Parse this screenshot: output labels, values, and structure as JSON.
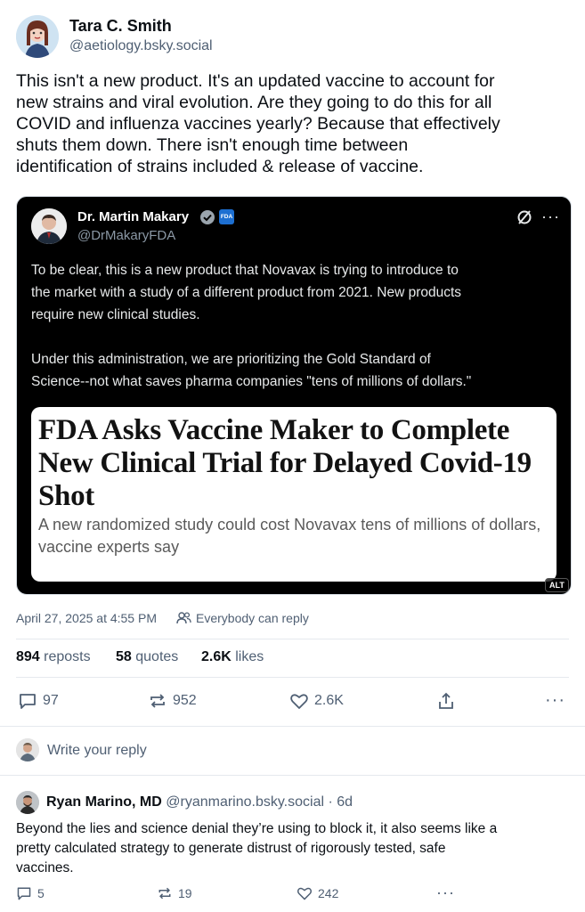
{
  "post": {
    "author_name": "Tara C. Smith",
    "author_handle": "@aetiology.bsky.social",
    "text_lines": [
      "This isn't a new product. It's an updated vaccine to account for",
      "new strains and viral evolution. Are they going to do this for all",
      "COVID and influenza vaccines yearly? Because that effectively",
      "shuts them down. There isn't enough time between",
      "identification of strains included & release of vaccine."
    ],
    "timestamp": "April 27, 2025 at 4:55 PM",
    "reply_setting": "Everybody can reply",
    "stats": {
      "reposts_count": "894",
      "reposts_label": "reposts",
      "quotes_count": "58",
      "quotes_label": "quotes",
      "likes_count": "2.6K",
      "likes_label": "likes"
    },
    "actions": {
      "replies": "97",
      "reposts": "952",
      "likes": "2.6K"
    }
  },
  "embed": {
    "author_name": "Dr. Martin Makary",
    "author_handle": "@DrMakaryFDA",
    "badge_text": "FDA",
    "paragraph1_lines": [
      "To be clear, this is a new product that Novavax is trying to introduce to",
      "the market with a study of a different product from 2021. New products",
      "require new clinical studies."
    ],
    "paragraph2_lines": [
      "Under this administration, we are prioritizing the Gold Standard of",
      "Science--not what saves pharma companies \"tens of millions of dollars.\""
    ],
    "headline_lines": [
      "FDA Asks Vaccine Maker to Complete",
      "New Clinical Trial for Delayed Covid-19",
      "Shot"
    ],
    "dek_lines": [
      "A new randomized study could cost Novavax tens of millions of dollars,",
      "vaccine experts say"
    ],
    "alt_label": "ALT"
  },
  "composer": {
    "placeholder": "Write your reply"
  },
  "reply": {
    "author_name": "Ryan Marino, MD",
    "author_handle": "@ryanmarino.bsky.social",
    "age": "· 6d",
    "text_lines": [
      "Beyond the lies and science denial they’re using to block it, it also seems like a",
      "pretty calculated strategy to generate distrust of rigorously tested, safe",
      "vaccines."
    ],
    "actions": {
      "replies": "5",
      "reposts": "19",
      "likes": "242"
    }
  },
  "colors": {
    "text": "#0b0f14",
    "muted": "#4f5f73",
    "embed_bg": "#000000",
    "fda_badge": "#1d6fd1",
    "verified": "#1d9bf0"
  },
  "icons": [
    "reply-icon",
    "repost-icon",
    "like-icon",
    "share-icon",
    "more-icon",
    "people-icon",
    "verified-icon",
    "mute-icon"
  ]
}
